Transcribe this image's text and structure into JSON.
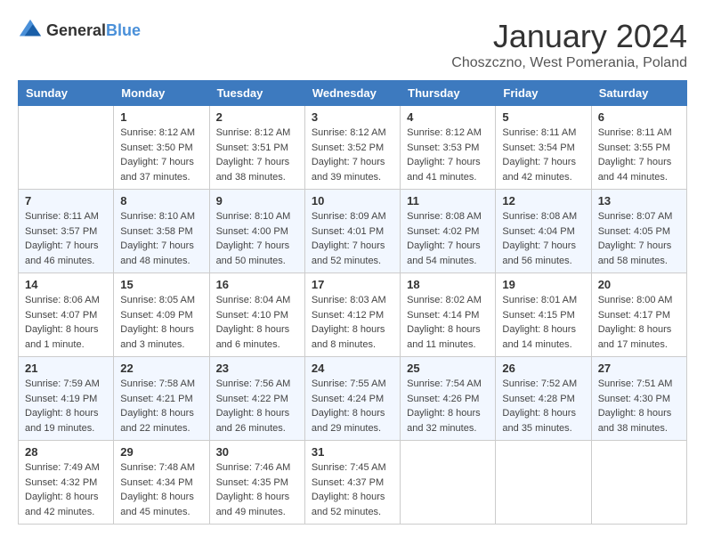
{
  "header": {
    "logo_general": "General",
    "logo_blue": "Blue",
    "month_title": "January 2024",
    "location": "Choszczno, West Pomerania, Poland"
  },
  "columns": [
    "Sunday",
    "Monday",
    "Tuesday",
    "Wednesday",
    "Thursday",
    "Friday",
    "Saturday"
  ],
  "weeks": [
    [
      {
        "day": "",
        "info": ""
      },
      {
        "day": "1",
        "info": "Sunrise: 8:12 AM\nSunset: 3:50 PM\nDaylight: 7 hours\nand 37 minutes."
      },
      {
        "day": "2",
        "info": "Sunrise: 8:12 AM\nSunset: 3:51 PM\nDaylight: 7 hours\nand 38 minutes."
      },
      {
        "day": "3",
        "info": "Sunrise: 8:12 AM\nSunset: 3:52 PM\nDaylight: 7 hours\nand 39 minutes."
      },
      {
        "day": "4",
        "info": "Sunrise: 8:12 AM\nSunset: 3:53 PM\nDaylight: 7 hours\nand 41 minutes."
      },
      {
        "day": "5",
        "info": "Sunrise: 8:11 AM\nSunset: 3:54 PM\nDaylight: 7 hours\nand 42 minutes."
      },
      {
        "day": "6",
        "info": "Sunrise: 8:11 AM\nSunset: 3:55 PM\nDaylight: 7 hours\nand 44 minutes."
      }
    ],
    [
      {
        "day": "7",
        "info": "Sunrise: 8:11 AM\nSunset: 3:57 PM\nDaylight: 7 hours\nand 46 minutes."
      },
      {
        "day": "8",
        "info": "Sunrise: 8:10 AM\nSunset: 3:58 PM\nDaylight: 7 hours\nand 48 minutes."
      },
      {
        "day": "9",
        "info": "Sunrise: 8:10 AM\nSunset: 4:00 PM\nDaylight: 7 hours\nand 50 minutes."
      },
      {
        "day": "10",
        "info": "Sunrise: 8:09 AM\nSunset: 4:01 PM\nDaylight: 7 hours\nand 52 minutes."
      },
      {
        "day": "11",
        "info": "Sunrise: 8:08 AM\nSunset: 4:02 PM\nDaylight: 7 hours\nand 54 minutes."
      },
      {
        "day": "12",
        "info": "Sunrise: 8:08 AM\nSunset: 4:04 PM\nDaylight: 7 hours\nand 56 minutes."
      },
      {
        "day": "13",
        "info": "Sunrise: 8:07 AM\nSunset: 4:05 PM\nDaylight: 7 hours\nand 58 minutes."
      }
    ],
    [
      {
        "day": "14",
        "info": "Sunrise: 8:06 AM\nSunset: 4:07 PM\nDaylight: 8 hours\nand 1 minute."
      },
      {
        "day": "15",
        "info": "Sunrise: 8:05 AM\nSunset: 4:09 PM\nDaylight: 8 hours\nand 3 minutes."
      },
      {
        "day": "16",
        "info": "Sunrise: 8:04 AM\nSunset: 4:10 PM\nDaylight: 8 hours\nand 6 minutes."
      },
      {
        "day": "17",
        "info": "Sunrise: 8:03 AM\nSunset: 4:12 PM\nDaylight: 8 hours\nand 8 minutes."
      },
      {
        "day": "18",
        "info": "Sunrise: 8:02 AM\nSunset: 4:14 PM\nDaylight: 8 hours\nand 11 minutes."
      },
      {
        "day": "19",
        "info": "Sunrise: 8:01 AM\nSunset: 4:15 PM\nDaylight: 8 hours\nand 14 minutes."
      },
      {
        "day": "20",
        "info": "Sunrise: 8:00 AM\nSunset: 4:17 PM\nDaylight: 8 hours\nand 17 minutes."
      }
    ],
    [
      {
        "day": "21",
        "info": "Sunrise: 7:59 AM\nSunset: 4:19 PM\nDaylight: 8 hours\nand 19 minutes."
      },
      {
        "day": "22",
        "info": "Sunrise: 7:58 AM\nSunset: 4:21 PM\nDaylight: 8 hours\nand 22 minutes."
      },
      {
        "day": "23",
        "info": "Sunrise: 7:56 AM\nSunset: 4:22 PM\nDaylight: 8 hours\nand 26 minutes."
      },
      {
        "day": "24",
        "info": "Sunrise: 7:55 AM\nSunset: 4:24 PM\nDaylight: 8 hours\nand 29 minutes."
      },
      {
        "day": "25",
        "info": "Sunrise: 7:54 AM\nSunset: 4:26 PM\nDaylight: 8 hours\nand 32 minutes."
      },
      {
        "day": "26",
        "info": "Sunrise: 7:52 AM\nSunset: 4:28 PM\nDaylight: 8 hours\nand 35 minutes."
      },
      {
        "day": "27",
        "info": "Sunrise: 7:51 AM\nSunset: 4:30 PM\nDaylight: 8 hours\nand 38 minutes."
      }
    ],
    [
      {
        "day": "28",
        "info": "Sunrise: 7:49 AM\nSunset: 4:32 PM\nDaylight: 8 hours\nand 42 minutes."
      },
      {
        "day": "29",
        "info": "Sunrise: 7:48 AM\nSunset: 4:34 PM\nDaylight: 8 hours\nand 45 minutes."
      },
      {
        "day": "30",
        "info": "Sunrise: 7:46 AM\nSunset: 4:35 PM\nDaylight: 8 hours\nand 49 minutes."
      },
      {
        "day": "31",
        "info": "Sunrise: 7:45 AM\nSunset: 4:37 PM\nDaylight: 8 hours\nand 52 minutes."
      },
      {
        "day": "",
        "info": ""
      },
      {
        "day": "",
        "info": ""
      },
      {
        "day": "",
        "info": ""
      }
    ]
  ]
}
